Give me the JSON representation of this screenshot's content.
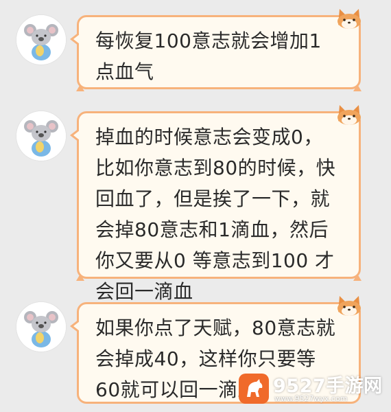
{
  "messages": [
    {
      "lines": [
        "每恢复100意志就会增加1",
        "点血气"
      ]
    },
    {
      "lines": [
        "掉血的时候意志会变成0，",
        "比如你意志到80的时候，快",
        "回血了，但是挨了一下，就",
        "会掉80意志和1滴血，然后",
        "你又要从0 等意志到100 才",
        "会回一滴血"
      ]
    },
    {
      "lines": [
        "如果你点了天赋，80意志就",
        "会掉成40，这样你只要等",
        "60就可以回一滴血"
      ]
    }
  ],
  "watermark": {
    "title": "9527手游网",
    "url": "www.9527wyx.com"
  },
  "colors": {
    "background": "#ebebeb",
    "bubble_border": "#f7b27b",
    "bubble_fill": "#fffaf0",
    "watermark_logo": "#f06a2a"
  },
  "icons": {
    "avatar": "koala-avatar-icon",
    "bubble_decoration": "shiba-dog-icon",
    "watermark_logo": "horse-logo-icon"
  }
}
